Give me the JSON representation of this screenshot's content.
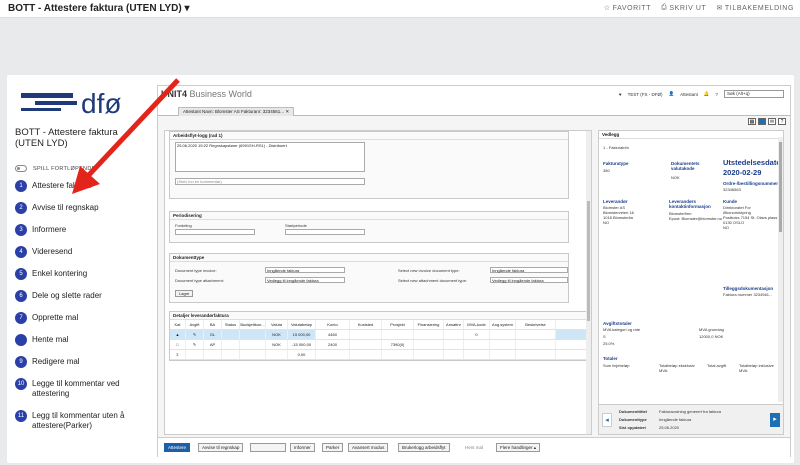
{
  "window": {
    "title": "BOTT - Attestere faktura (UTEN LYD)",
    "links": [
      {
        "icon": "star-icon",
        "label": "FAVORITT"
      },
      {
        "icon": "printer-icon",
        "label": "SKRIV UT"
      },
      {
        "icon": "mail-icon",
        "label": "TILBAKEMELDING"
      }
    ]
  },
  "sidebar": {
    "logo_text": "dfø",
    "heading": "BOTT - Attestere faktura (UTEN LYD)",
    "toggle_label": "SPILL FORTLØPENDE",
    "steps": [
      {
        "num": "1",
        "label": "Attestere faktura"
      },
      {
        "num": "2",
        "label": "Avvise til regnskap"
      },
      {
        "num": "3",
        "label": "Informere"
      },
      {
        "num": "4",
        "label": "Videresend"
      },
      {
        "num": "5",
        "label": "Enkel kontering"
      },
      {
        "num": "6",
        "label": "Dele og slette rader"
      },
      {
        "num": "7",
        "label": "Opprette mal"
      },
      {
        "num": "",
        "label": "Hente mal"
      },
      {
        "num": "9",
        "label": "Redigere mal"
      },
      {
        "num": "10",
        "label": "Legge til kommentar ved attestering"
      },
      {
        "num": "11",
        "label": "Legg til kommentar uten å attestere(Parker)"
      }
    ]
  },
  "app": {
    "brand": "UNIT4",
    "brand_sub": "Business World",
    "header_right": {
      "user": "TEST (FS - DFØ)",
      "attestant": "Attestant",
      "search_placeholder": "Søk (Alt+q)"
    },
    "tab": "Attestant Navn: Blomster AS Fakturanr: 3234561...",
    "sections": {
      "attestering_title": "Arbeidsflyt-logg (rad 1)",
      "log_text": "25.06.2020 15:22 Regnskapsfører (6991SH-RS1) - Distribuert",
      "comment_placeholder": "(Skriv inn en kommentar)",
      "periodisering_title": "Periodisering",
      "fordeling_label": "Fordeling",
      "startperiode_label": "Startperiode",
      "dokumenttype_title": "Dokumenttype",
      "doctype_invoice_label": "Document type invoice:",
      "doctype_invoice_value": "Inngående faktura",
      "doctype_attach_label": "Document type attachment:",
      "doctype_attach_value": "Vedlegg til inngående faktura",
      "select_new_invoice_label": "Select new invoice document type:",
      "select_new_invoice_value": "Inngående faktura",
      "select_new_attach_label": "Select new attachment document type:",
      "select_new_attach_value": "Vedlegg til inngående faktura",
      "lagre": "Lagre"
    },
    "grid": {
      "title": "Detaljer leverandørfaktura",
      "headers": [
        "Kat",
        "Avgift",
        "BA",
        "Status",
        "Budsjettkon...",
        "Valuta",
        "Valutabeløp",
        "Konto",
        "Koststed",
        "Prosjekt",
        "Finansiering",
        "Ansattnr",
        "MVA-kode",
        "Ang.system",
        "Beskrivelse"
      ],
      "rows": [
        [
          "",
          "GL",
          "",
          "",
          "",
          "NOK",
          "15 000,00",
          "4460",
          "",
          "",
          "",
          "",
          "0",
          "",
          ""
        ],
        [
          "",
          "AP",
          "",
          "",
          "",
          "NOK",
          "-15 000,00",
          "2400",
          "",
          "",
          "",
          "",
          "",
          "",
          ""
        ],
        [
          "Σ",
          "",
          "",
          "",
          "",
          "",
          "0,00",
          "",
          "",
          "",
          "",
          "",
          "",
          "",
          ""
        ]
      ],
      "project_val": "7390(0)"
    },
    "doc": {
      "title": "Vedlegg",
      "subtitle": "1 - Fakturainfo",
      "fakturatype_lbl": "Fakturatype",
      "fakturatype_val": "380",
      "dokvaluta_lbl": "Dokumentets valutakode",
      "dokvaluta_val": "NOK",
      "utstedelsesdato_lbl": "Utstedelsesdato",
      "utstedelsesdato_val": "2020-02-29",
      "ordre_lbl": "Ordre-/bestillingsnummer",
      "ordre_val": "32346563",
      "leverandor_lbl": "Leverandør",
      "leverandor_val": "Blomster AS\nBlomsterveien 16\n1018 Blomsterlia\nNO",
      "kontakt_lbl": "Leverandørs kontaktinformasjon",
      "kontakt_val": "Blomsterfirm\nEpost: Blomster@blomster.no",
      "kunde_lbl": "Kunde",
      "kunde_val": "Direktoratet For Økonomistyring\nPostboks 7154 St. Olavs plass\n0130 OSLO\nNO",
      "tillegg_lbl": "Tilleggsdokumentasjon",
      "tillegg_val": "Faktura nummer 3234561...",
      "avgifttotaler_lbl": "Avgiftstotaler",
      "mva_kat_lbl": "MVA kategori og rate",
      "mva_kat_val": "S",
      "mva_grunnlag_lbl": "MVA grunnlag",
      "mva_grunnlag_val": "12000,0 NOK",
      "rate_val": "25.0%",
      "totaler_lbl": "Totaler",
      "sum_lbl": "Sum linjebeløp",
      "total_eks_lbl": "Totalbeløp eksklusiv MVA",
      "total_avgift_lbl": "Total avgift",
      "total_inkl_lbl": "Totalbeløp inklusive MVA",
      "pager": [
        {
          "k": "Dokumenttittel",
          "v": "Fakturaordning generert fra faktura"
        },
        {
          "k": "Dokumenttype",
          "v": "Inngående faktura"
        },
        {
          "k": "Sist oppdatert",
          "v": "25.06.2020"
        }
      ]
    },
    "bottom_buttons": [
      "Attestere",
      "Avvise til regnskap",
      "",
      "Informer",
      "Parker",
      "Avansert modus",
      "Brukerlogg arbeidsflyt",
      "Hent mal",
      "Flere handlinger"
    ]
  },
  "colors": {
    "arrow": "#e3241b",
    "step": "#2a3fa8",
    "logo": "#1f3a7a"
  }
}
